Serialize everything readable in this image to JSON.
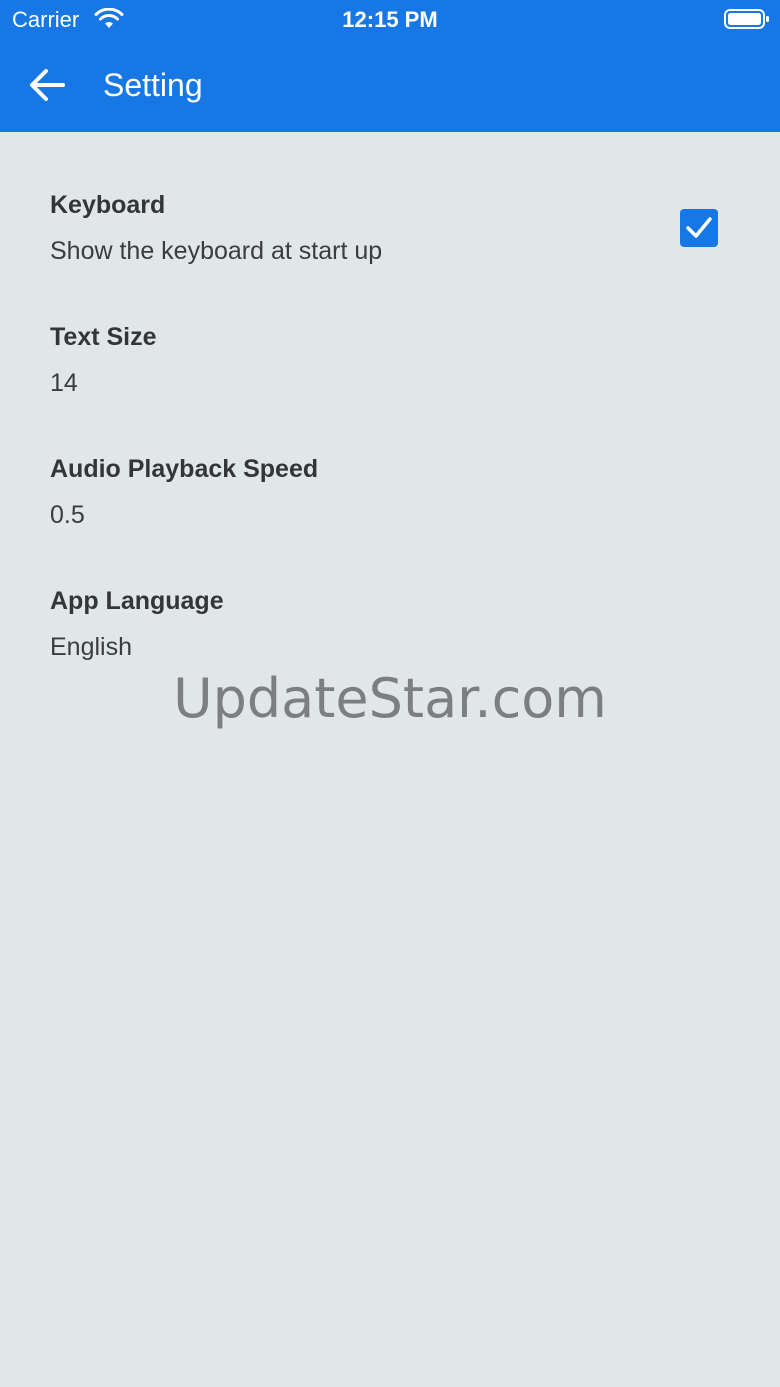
{
  "status_bar": {
    "carrier": "Carrier",
    "time": "12:15 PM",
    "icons": [
      "wifi-icon",
      "battery-icon"
    ]
  },
  "header": {
    "title": "Setting",
    "back_icon": "arrow-left-icon"
  },
  "settings": {
    "keyboard": {
      "label": "Keyboard",
      "value": "Show the keyboard at start up",
      "checked": true
    },
    "text_size": {
      "label": "Text Size",
      "value": "14"
    },
    "audio_speed": {
      "label": "Audio Playback Speed",
      "value": "0.5"
    },
    "app_language": {
      "label": "App Language",
      "value": "English"
    }
  },
  "watermark": "UpdateStar.com",
  "colors": {
    "accent": "#1677e5",
    "background": "#e1e6e9",
    "text": "#333639"
  }
}
